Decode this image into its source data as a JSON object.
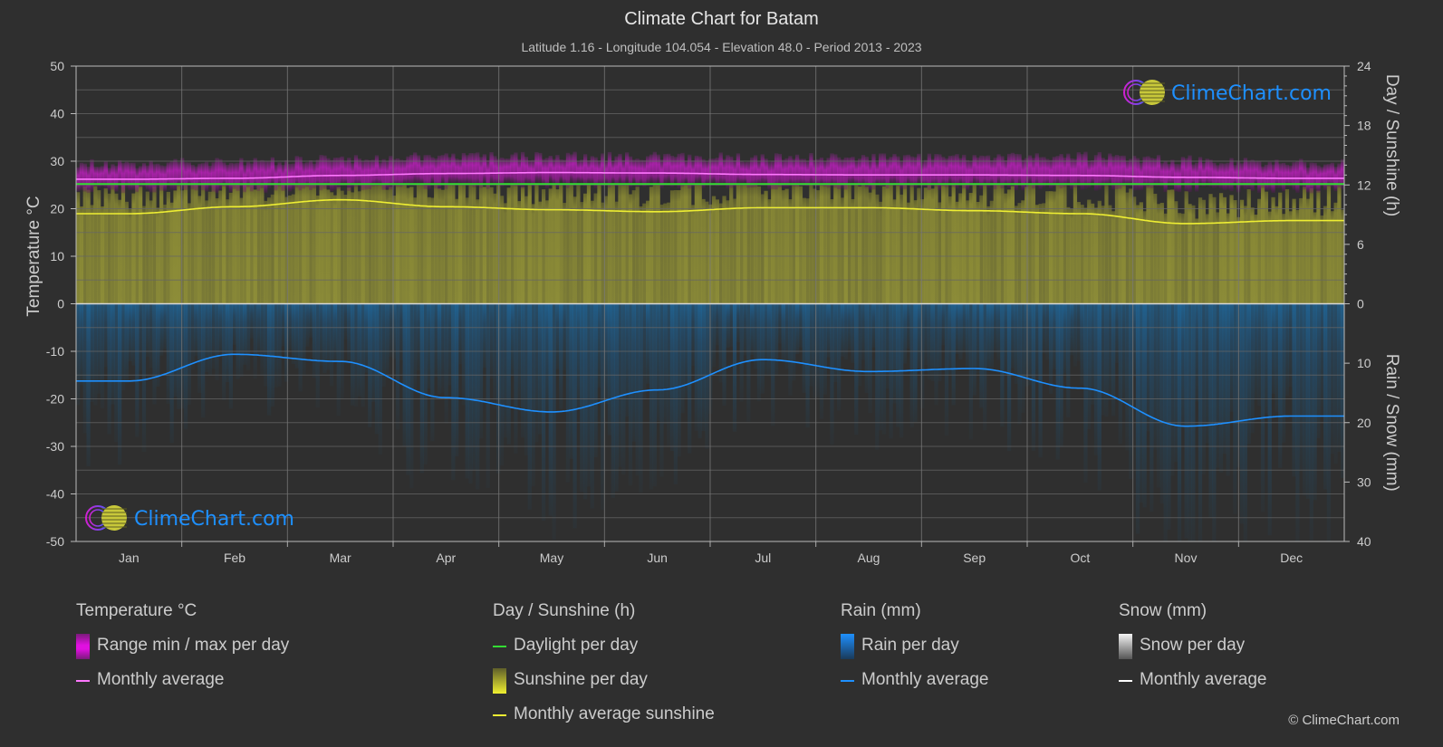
{
  "title": "Climate Chart for Batam",
  "subtitle": "Latitude 1.16 - Longitude 104.054 - Elevation 48.0 - Period 2013 - 2023",
  "watermark": "ClimeChart.com",
  "copyright": "© ClimeChart.com",
  "colors": {
    "background": "#2f2f2f",
    "temp_range": "#c81ec8",
    "temp_avg": "#ff77ff",
    "daylight": "#33dd33",
    "sunshine_fill": "#8c8c35",
    "sunshine_avg": "#eeee33",
    "rain_fill": "#1f5f8f",
    "rain_avg": "#1e90ff",
    "snow_avg": "#ffffff",
    "logo_text": "#1e90ff"
  },
  "legend": {
    "temperature": {
      "title": "Temperature °C",
      "items": [
        {
          "label": "Range min / max per day",
          "icon": "range-swatch"
        },
        {
          "label": "Monthly average",
          "icon": "line-swatch"
        }
      ]
    },
    "sunshine": {
      "title": "Day / Sunshine (h)",
      "items": [
        {
          "label": "Daylight per day",
          "icon": "line-swatch"
        },
        {
          "label": "Sunshine per day",
          "icon": "bar-swatch"
        },
        {
          "label": "Monthly average sunshine",
          "icon": "line-swatch"
        }
      ]
    },
    "rain": {
      "title": "Rain (mm)",
      "items": [
        {
          "label": "Rain per day",
          "icon": "bar-swatch"
        },
        {
          "label": "Monthly average",
          "icon": "line-swatch"
        }
      ]
    },
    "snow": {
      "title": "Snow (mm)",
      "items": [
        {
          "label": "Snow per day",
          "icon": "bar-swatch"
        },
        {
          "label": "Monthly average",
          "icon": "line-swatch"
        }
      ]
    }
  },
  "chart_data": {
    "type": "line",
    "title": "Climate Chart for Batam",
    "subtitle": "Latitude 1.16 - Longitude 104.054 - Elevation 48.0 - Period 2013 - 2023",
    "categories": [
      "Jan",
      "Feb",
      "Mar",
      "Apr",
      "May",
      "Jun",
      "Jul",
      "Aug",
      "Sep",
      "Oct",
      "Nov",
      "Dec"
    ],
    "grid": true,
    "legend_position": "bottom",
    "axes": {
      "left": {
        "label": "Temperature °C",
        "range": [
          -50,
          50
        ],
        "ticks": [
          50,
          40,
          30,
          20,
          10,
          0,
          -10,
          -20,
          -30,
          -40,
          -50
        ]
      },
      "right_top": {
        "label": "Day / Sunshine (h)",
        "range": [
          0,
          24
        ],
        "ticks": [
          24,
          18,
          12,
          6,
          0
        ]
      },
      "right_bottom": {
        "label": "Rain / Snow (mm)",
        "range": [
          0,
          40
        ],
        "ticks": [
          0,
          10,
          20,
          30,
          40
        ]
      }
    },
    "series": [
      {
        "name": "Temperature monthly average (°C)",
        "axis": "left",
        "values": [
          26.2,
          26.4,
          27.0,
          27.4,
          27.6,
          27.5,
          27.2,
          27.1,
          27.1,
          27.0,
          26.6,
          26.4
        ]
      },
      {
        "name": "Temperature range min (°C)",
        "axis": "left",
        "values": [
          24.0,
          24.0,
          24.3,
          24.8,
          25.0,
          25.0,
          24.8,
          24.7,
          24.6,
          24.5,
          24.2,
          24.0
        ]
      },
      {
        "name": "Temperature range max (°C)",
        "axis": "left",
        "values": [
          29.5,
          30.0,
          30.5,
          31.0,
          31.0,
          31.0,
          30.8,
          30.7,
          30.8,
          31.0,
          30.3,
          29.6
        ]
      },
      {
        "name": "Daylight per day (h)",
        "axis": "right_top",
        "values": [
          12.1,
          12.1,
          12.1,
          12.1,
          12.1,
          12.1,
          12.1,
          12.1,
          12.1,
          12.1,
          12.1,
          12.1
        ]
      },
      {
        "name": "Monthly average sunshine (h)",
        "axis": "right_top",
        "values": [
          9.1,
          9.8,
          10.5,
          9.8,
          9.5,
          9.3,
          9.7,
          9.7,
          9.4,
          9.1,
          8.1,
          8.4
        ]
      },
      {
        "name": "Rain monthly average (mm)",
        "axis": "right_bottom",
        "values": [
          13.0,
          8.5,
          9.7,
          15.8,
          18.2,
          14.5,
          9.4,
          11.4,
          10.9,
          14.2,
          20.6,
          18.9
        ]
      },
      {
        "name": "Snow monthly average (mm)",
        "axis": "right_bottom",
        "values": [
          0,
          0,
          0,
          0,
          0,
          0,
          0,
          0,
          0,
          0,
          0,
          0
        ]
      }
    ]
  }
}
